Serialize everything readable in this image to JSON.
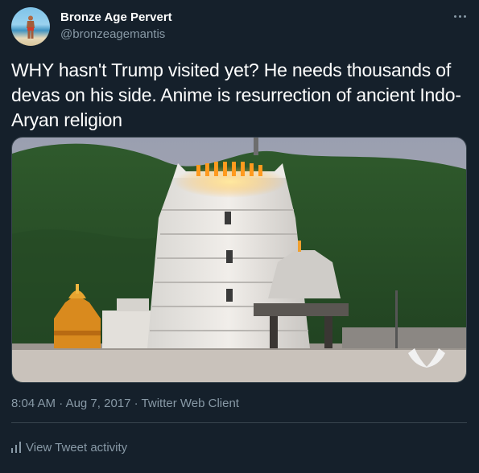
{
  "author": {
    "name": "Bronze Age Pervert",
    "handle": "@bronzeagemantis",
    "avatar_icon": "avatar-image"
  },
  "tweet": {
    "text": "WHY hasn't Trump visited yet? He needs thousands of devas on his side. Anime is resurrection of ancient Indo-Aryan religion",
    "media_description_icon": "temple-photo",
    "time": "8:04 AM",
    "date": "Aug 7, 2017",
    "source": "Twitter Web Client",
    "separator": "·"
  },
  "footer": {
    "activity_label": "View Tweet activity",
    "activity_icon": "bar-chart-icon"
  },
  "colors": {
    "background": "#15202b",
    "primary_text": "#ffffff",
    "secondary_text": "#8899a6",
    "border": "#38444d"
  }
}
